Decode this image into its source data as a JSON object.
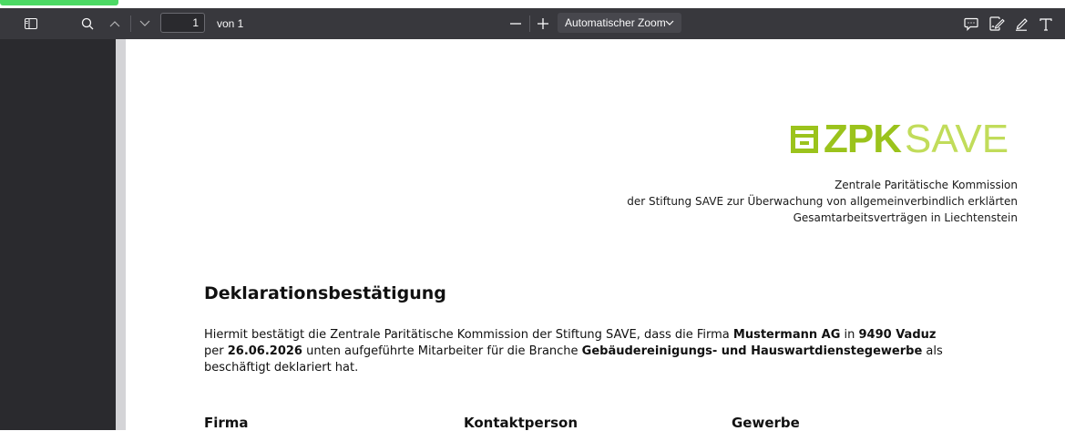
{
  "toolbar": {
    "page_current": "1",
    "page_of": "von 1",
    "zoom_label": "Automatischer Zoom",
    "icons": [
      "sidebar-toggle-icon",
      "search-icon",
      "chevron-up-icon",
      "chevron-down-icon",
      "zoom-out-icon",
      "zoom-in-icon",
      "comment-icon",
      "signature-icon",
      "highlight-icon",
      "text-icon"
    ],
    "bg_color": "#38383d",
    "accent_color": "#4cd964"
  },
  "document": {
    "logo_bold": "ZPK",
    "logo_light": "SAVE",
    "org_line1": "Zentrale Paritätische Kommission",
    "org_line2": "der Stiftung SAVE zur Überwachung von allgemeinverbindlich erklärten",
    "org_line3": "Gesamtarbeitsverträgen in Liechtenstein",
    "title": "Deklarationsbestätigung",
    "body_part1": "Hiermit bestätigt die Zentrale Paritätische Kommission der Stiftung SAVE, dass die Firma ",
    "body_company": "Mustermann AG",
    "body_part2": "  in ",
    "body_location": "9490 Vaduz",
    "body_part3": "per ",
    "body_date": "26.06.2026",
    "body_part4": " unten aufgeführte Mitarbeiter für die Branche ",
    "body_branch": "Gebäudereinigungs- und Hauswartdienstegewerbe",
    "body_part5": " als",
    "body_part6": "beschäftigt deklariert hat.",
    "col_firma": "Firma",
    "col_kontakt": "Kontaktperson",
    "col_gewerbe": "Gewerbe",
    "logo_color": "#9bc31c"
  }
}
